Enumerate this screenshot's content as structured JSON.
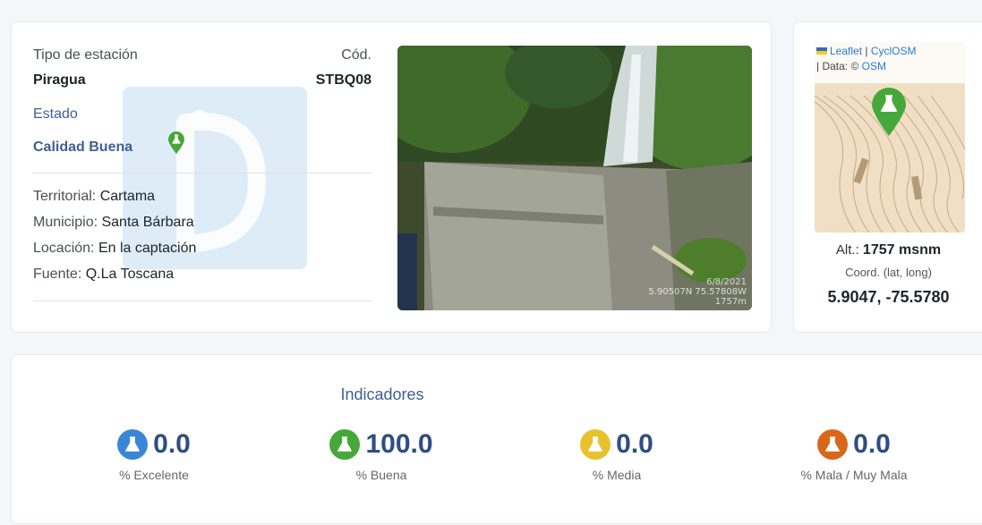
{
  "station": {
    "tipo_label": "Tipo de estación",
    "tipo_value": "Piragua",
    "cod_label": "Cód.",
    "cod_value": "STBQ08",
    "estado_label": "Estado",
    "estado_value": "Calidad Buena",
    "details": [
      {
        "label": "Territorial:",
        "value": "Cartama"
      },
      {
        "label": "Municipio:",
        "value": "Santa Bárbara"
      },
      {
        "label": "Locación:",
        "value": "En la captación"
      },
      {
        "label": "Fuente:",
        "value": "Q.La Toscana"
      }
    ]
  },
  "photo": {
    "icon": "station-photo",
    "stamp": "6/8/2021\n5.90507N 75.57808W\n1757m"
  },
  "map": {
    "attribution_leaflet": "Leaflet",
    "attribution_sep": " | ",
    "attribution_cyclosm": "CyclOSM",
    "attribution_data": "| Data: © ",
    "attribution_osm": "OSM",
    "alt_label": "Alt.:",
    "alt_value": "1757 msnm",
    "coord_label": "Coord. (lat, long)",
    "coord_value": "5.9047, -75.5780"
  },
  "indicators": {
    "title": "Indicadores",
    "items": [
      {
        "value": "0.0",
        "label": "% Excelente",
        "color": "#3a86d6"
      },
      {
        "value": "100.0",
        "label": "% Buena",
        "color": "#46a83a"
      },
      {
        "value": "0.0",
        "label": "% Media",
        "color": "#e8c12f"
      },
      {
        "value": "0.0",
        "label": "% Mala / Muy Mala",
        "color": "#d9671a"
      }
    ]
  },
  "colors": {
    "accent": "#3f5f93",
    "good": "#46a83a"
  }
}
